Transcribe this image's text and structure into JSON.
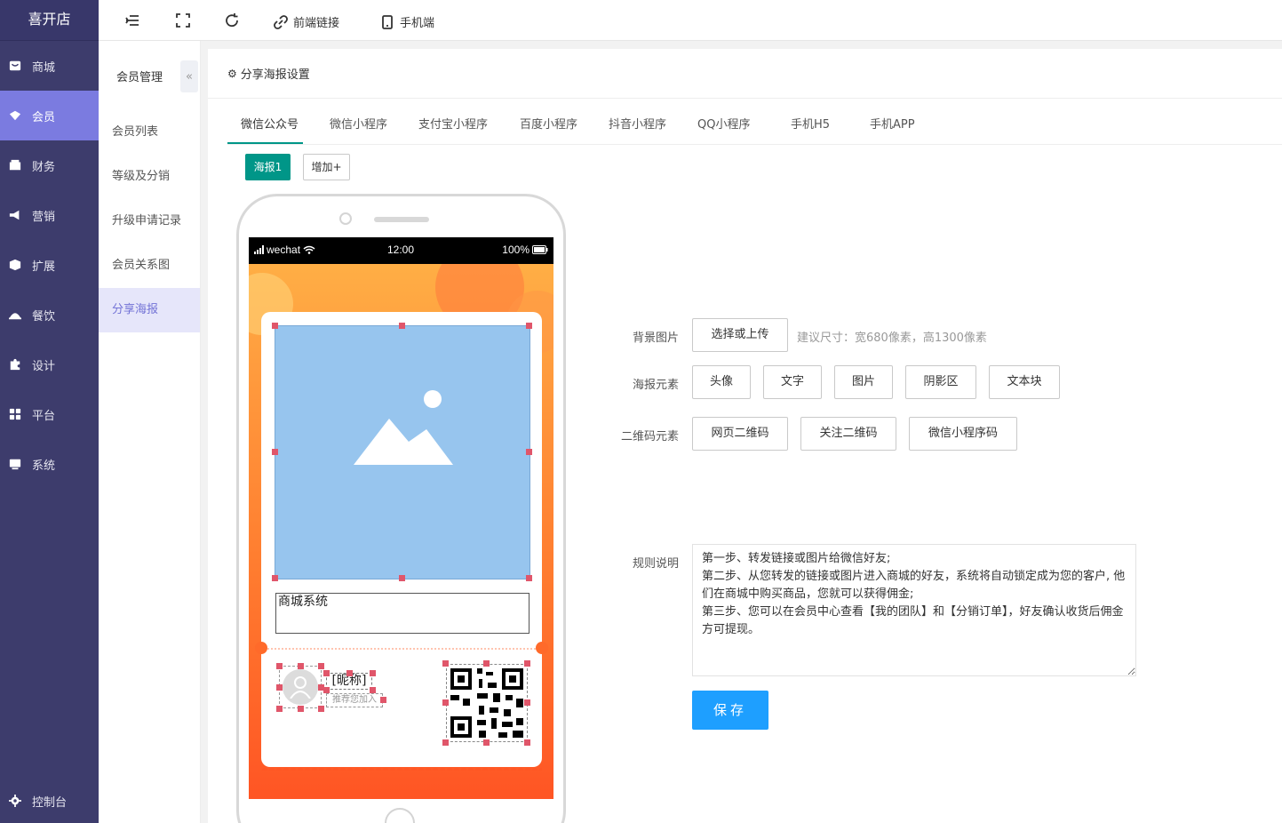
{
  "brand": "喜开店",
  "sidebar": {
    "items": [
      {
        "label": "商城",
        "icon": "store-icon"
      },
      {
        "label": "会员",
        "icon": "member-icon"
      },
      {
        "label": "财务",
        "icon": "finance-icon"
      },
      {
        "label": "营销",
        "icon": "megaphone-icon"
      },
      {
        "label": "扩展",
        "icon": "cube-icon"
      },
      {
        "label": "餐饮",
        "icon": "food-icon"
      },
      {
        "label": "设计",
        "icon": "puzzle-icon"
      },
      {
        "label": "平台",
        "icon": "grid-icon"
      },
      {
        "label": "系统",
        "icon": "system-icon"
      }
    ],
    "bottom": {
      "label": "控制台",
      "icon": "gear-icon"
    }
  },
  "topbar": {
    "link_label": "前端链接",
    "mobile_label": "手机端"
  },
  "subsidebar": {
    "title": "会员管理",
    "collapse": "«",
    "items": [
      "会员列表",
      "等级及分销",
      "升级申请记录",
      "会员关系图",
      "分享海报"
    ]
  },
  "panel": {
    "title": "分享海报设置",
    "gear": "⚙"
  },
  "tabs": [
    "微信公众号",
    "微信小程序",
    "支付宝小程序",
    "百度小程序",
    "抖音小程序",
    "QQ小程序",
    "手机H5",
    "手机APP"
  ],
  "posters": {
    "current": "海报1",
    "add": "增加+"
  },
  "phone": {
    "carrier": "wechat",
    "time": "12:00",
    "battery": "100%",
    "text_element": "商城系统",
    "nickname": "[昵称]",
    "recommend": "推荐您加入"
  },
  "form": {
    "bg_label": "背景图片",
    "bg_button": "选择或上传",
    "bg_hint": "建议尺寸：宽680像素，高1300像素",
    "elements_label": "海报元素",
    "elements": [
      "头像",
      "文字",
      "图片",
      "阴影区",
      "文本块"
    ],
    "qr_label": "二维码元素",
    "qr_elements": [
      "网页二维码",
      "关注二维码",
      "微信小程序码"
    ],
    "rules_label": "规则说明",
    "rules_text": "第一步、转发链接或图片给微信好友;\n第二步、从您转发的链接或图片进入商城的好友，系统将自动锁定成为您的客户, 他们在商城中购买商品，您就可以获得佣金;\n第三步、您可以在会员中心查看【我的团队】和【分销订单】，好友确认收货后佣金方可提现。",
    "save": "保存"
  },
  "colors": {
    "sidebar_bg": "#3d3c6c",
    "sidebar_active": "#7b7be0",
    "accent_green": "#009688",
    "save_blue": "#1e9fff",
    "image_placeholder": "#97c5ee",
    "handle_red": "#e0566a"
  }
}
